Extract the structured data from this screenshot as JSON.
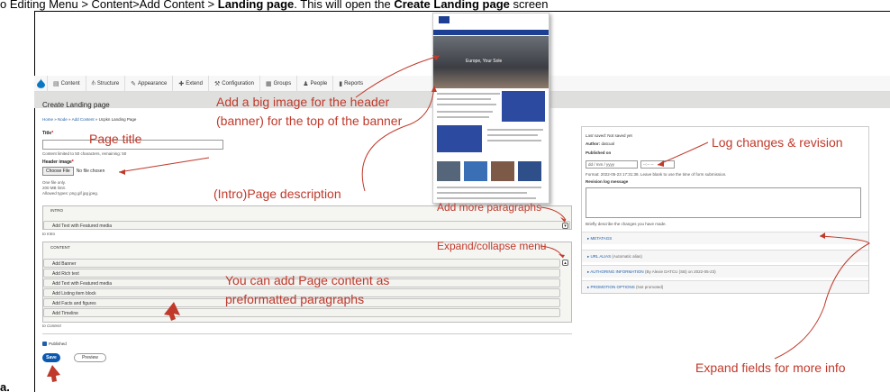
{
  "caption": {
    "text": "o Editing Menu > Content>Add Content > ",
    "bold1": "Landing page",
    "mid": ". This will open the ",
    "bold2": "Create Landing page",
    "end": " screen"
  },
  "admin_bar": {
    "items": [
      {
        "icon": "file-icon",
        "label": "Content"
      },
      {
        "icon": "structure-icon",
        "label": "Structure"
      },
      {
        "icon": "appearance-icon",
        "label": "Appearance"
      },
      {
        "icon": "extend-icon",
        "label": "Extend"
      },
      {
        "icon": "wrench-icon",
        "label": "Configuration"
      },
      {
        "icon": "groups-icon",
        "label": "Groups"
      },
      {
        "icon": "people-icon",
        "label": "People"
      },
      {
        "icon": "reports-icon",
        "label": "Reports"
      }
    ]
  },
  "page": {
    "title": "Create Landing page",
    "breadcrumb": [
      "Home",
      "Node",
      "Add Content",
      "Ucpkn Landing Page"
    ]
  },
  "form": {
    "title_label": "Title",
    "title_help": "Content limited to 50 characters, remaining: 50",
    "header_image_label": "Header image",
    "choose_file": "Choose File",
    "no_file": "No file chosen",
    "file_help": [
      "One file only.",
      "200 MB limit.",
      "Allowed types: png gif jpg jpeg."
    ],
    "intro": {
      "header": "INTRO",
      "items": [
        "Add Text with Featured media"
      ],
      "to_label": "to Intro"
    },
    "content": {
      "header": "CONTENT",
      "items": [
        "Add Banner",
        "Add Rich text",
        "Add Text with Featured media",
        "Add Listing item block",
        "Add Facts and figures",
        "Add Timeline"
      ],
      "to_label": "to Content"
    },
    "published_label": "Published",
    "save": "Save",
    "preview": "Preview"
  },
  "sidebar": {
    "last_saved_label": "Last saved:",
    "last_saved_value": "Not saved yet",
    "author_label": "Author:",
    "author_value": "datcual",
    "published_on_label": "Published on",
    "date_placeholder": "dd / mm / yyyy",
    "time_placeholder": "--:-- --",
    "format_help": "Format: 2022-05-23 17:31:38. Leave blank to use the time of form submission.",
    "revision_label": "Revision log message",
    "revision_help": "Briefly describe the changes you have made.",
    "sections": [
      {
        "label": "METATAGS",
        "note": ""
      },
      {
        "label": "URL ALIAS",
        "note": "(Automatic alias)"
      },
      {
        "label": "AUTHORING INFORMATION",
        "note": "(By Alexie DATCU (SB) on 2022-05-23)"
      },
      {
        "label": "PROMOTION OPTIONS",
        "note": "(Not promoted)"
      }
    ]
  },
  "annotations": {
    "header_image_1": "Add a big image for the header",
    "header_image_2": "(banner) for the top of the banner",
    "page_title": "Page title",
    "intro_desc": "(Intro)Page description",
    "add_paragraphs": "Add more paragraphs",
    "expand_collapse": "Expand/collapse menu",
    "page_content_1": "You can add Page content as",
    "page_content_2": "preformatted paragraphs",
    "log_changes": "Log changes & revision",
    "expand_fields": "Expand fields for more info"
  },
  "thumbnail": {
    "hero_text": "Europe, Your Sole"
  },
  "bottom_label": "a.",
  "colors": {
    "annotation": "#c0392b",
    "save_button": "#0a58b0",
    "link": "#1f5fa8"
  }
}
